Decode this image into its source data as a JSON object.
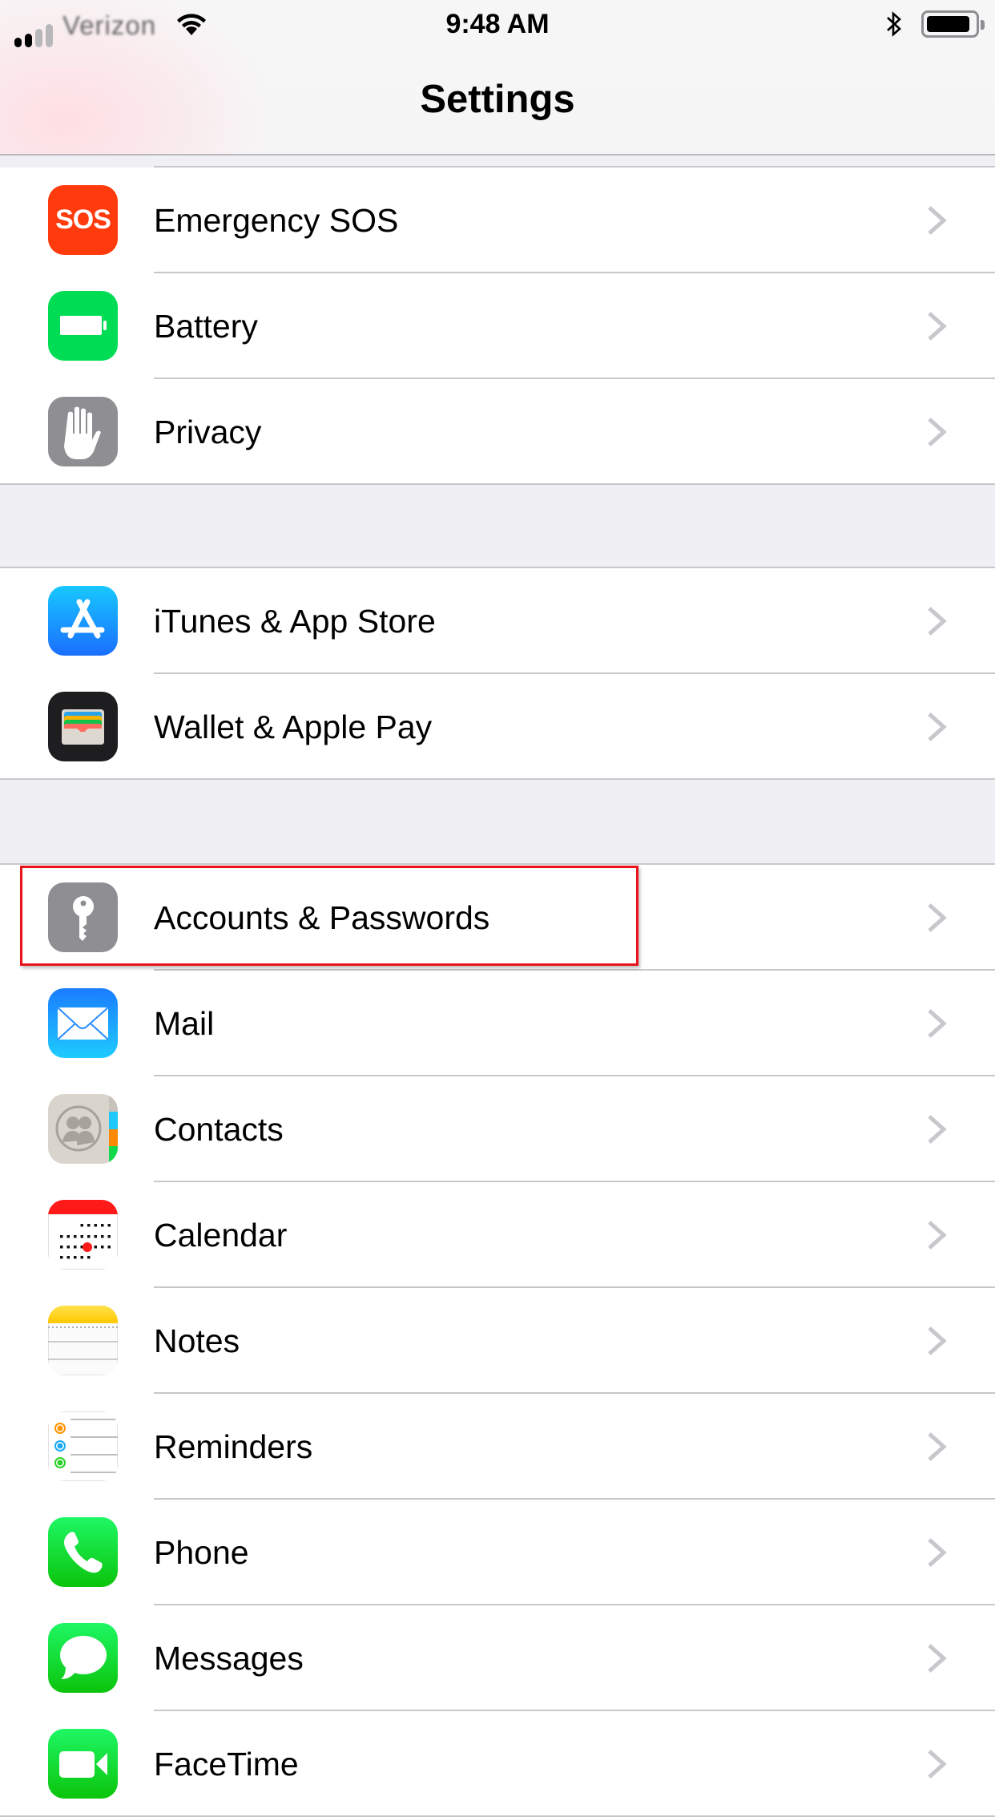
{
  "status_bar": {
    "carrier": "Verizon",
    "signal_bars_filled": 2,
    "signal_bars_total": 4,
    "time": "9:48 AM",
    "bluetooth": "bluetooth-icon",
    "wifi": "wifi-icon",
    "battery_level": 0.95
  },
  "nav": {
    "title": "Settings"
  },
  "colors": {
    "chevron": "#c7c7cc",
    "separator": "#c8c7cc",
    "group_background": "#efeff4",
    "highlight": "#e8141a"
  },
  "groups": [
    {
      "items": [
        {
          "label": "Emergency SOS",
          "icon": "sos-icon",
          "icon_text": "SOS",
          "color": "#ff3b0a"
        },
        {
          "label": "Battery",
          "icon": "battery-icon",
          "color": "#00dd55"
        },
        {
          "label": "Privacy",
          "icon": "hand-icon",
          "color": "#8e8e93"
        }
      ]
    },
    {
      "items": [
        {
          "label": "iTunes & App Store",
          "icon": "app-store-icon",
          "color": "#1a8cff"
        },
        {
          "label": "Wallet & Apple Pay",
          "icon": "wallet-icon",
          "color": "#1c1c1e"
        }
      ]
    },
    {
      "items": [
        {
          "label": "Accounts & Passwords",
          "icon": "key-icon",
          "color": "#8e8e93",
          "highlighted": true
        },
        {
          "label": "Mail",
          "icon": "mail-icon",
          "color": "#1e90ff"
        },
        {
          "label": "Contacts",
          "icon": "contacts-icon",
          "color": "#d9d5cc"
        },
        {
          "label": "Calendar",
          "icon": "calendar-icon",
          "color": "#ff1a1a"
        },
        {
          "label": "Notes",
          "icon": "notes-icon",
          "color": "#ffd60a"
        },
        {
          "label": "Reminders",
          "icon": "reminders-icon",
          "color": "#ffffff"
        },
        {
          "label": "Phone",
          "icon": "phone-icon",
          "color": "#1ed760"
        },
        {
          "label": "Messages",
          "icon": "messages-icon",
          "color": "#1ed760"
        },
        {
          "label": "FaceTime",
          "icon": "facetime-icon",
          "color": "#1ed760"
        }
      ]
    }
  ]
}
